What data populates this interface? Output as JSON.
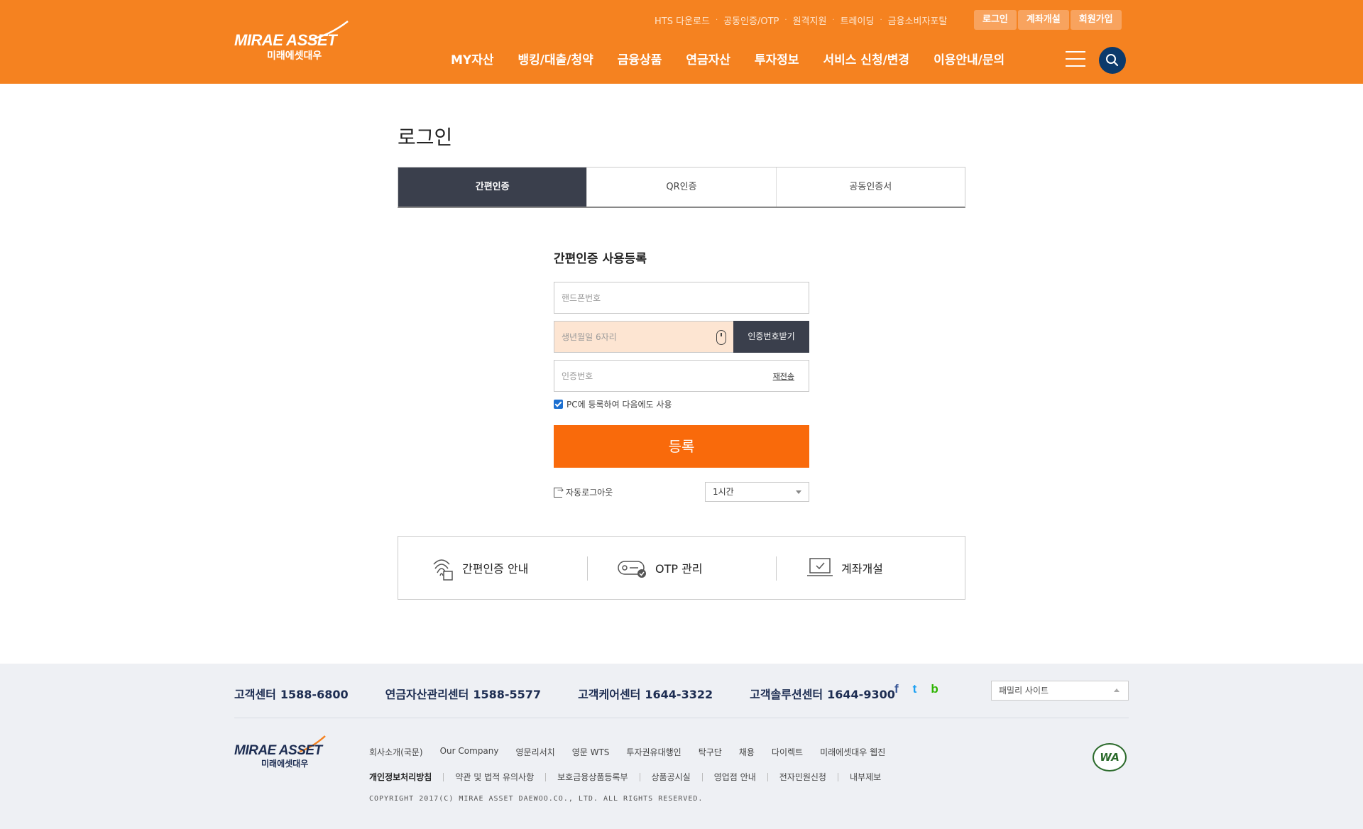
{
  "header": {
    "logo_text": "MIRAE ASSET",
    "logo_sub": "미래에셋대우",
    "util_links": [
      "HTS 다운로드",
      "공동인증/OTP",
      "원격지원",
      "트레이딩",
      "금융소비자포탈"
    ],
    "auth_buttons": [
      "로그인",
      "계좌개설",
      "회원가입"
    ],
    "nav": [
      "MY자산",
      "뱅킹/대출/청약",
      "금융상품",
      "연금자산",
      "투자정보",
      "서비스 신청/변경",
      "이용안내/문의"
    ],
    "colors": {
      "bar": "#f58220",
      "search": "#0c3a6b"
    }
  },
  "page": {
    "title": "로그인",
    "tabs": [
      "간편인증",
      "QR인증",
      "공동인증서"
    ],
    "active_tab": "간편인증"
  },
  "form": {
    "title": "간편인증 사용등록",
    "phone_placeholder": "핸드폰번호",
    "birth_placeholder": "생년월일 6자리",
    "get_code_label": "인증번호받기",
    "code_placeholder": "인증번호",
    "resend_label": "재전송",
    "remember_label": "PC에 등록하여 다음에도 사용",
    "remember_checked": true,
    "submit_label": "등록",
    "auto_logout_label": "자동로그아웃",
    "auto_logout_value": "1시간",
    "submit_color": "#f96a0b"
  },
  "quick_links": [
    {
      "label": "간편인증 안내",
      "icon": "fingerprint-icon"
    },
    {
      "label": "OTP 관리",
      "icon": "otp-card-icon"
    },
    {
      "label": "계좌개설",
      "icon": "laptop-check-icon"
    }
  ],
  "footer": {
    "phones": [
      {
        "name": "고객센터",
        "num": "1588-6800"
      },
      {
        "name": "연금자산관리센터",
        "num": "1588-5577"
      },
      {
        "name": "고객케어센터",
        "num": "1644-3322"
      },
      {
        "name": "고객솔루션센터",
        "num": "1644-9300"
      }
    ],
    "sns": [
      "f",
      "t",
      "b"
    ],
    "family_site": "패밀리 사이트",
    "links1": [
      "회사소개(국문)",
      "Our Company",
      "영문리서치",
      "영문 WTS",
      "투자권유대행인",
      "탁구단",
      "채용",
      "다이렉트",
      "미래에셋대우 웹진"
    ],
    "links2": [
      "개인정보처리방침",
      "약관 및 법적 유의사항",
      "보호금융상품등록부",
      "상품공시실",
      "영업점 안내",
      "전자민원신청",
      "내부제보"
    ],
    "copyright": "COPYRIGHT 2017(C) MIRAE ASSET DAEWOO.CO., LTD. ALL RIGHTS RESERVED.",
    "wa_mark": "WA"
  }
}
